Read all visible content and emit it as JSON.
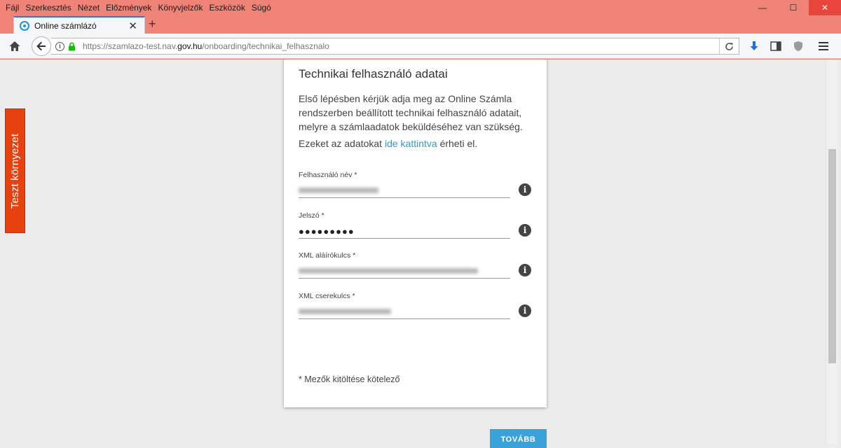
{
  "menu": [
    {
      "label": "Fájl"
    },
    {
      "label": "Szerkesztés"
    },
    {
      "label": "Nézet"
    },
    {
      "label": "Előzmények"
    },
    {
      "label": "Könyvjelzők"
    },
    {
      "label": "Eszközök"
    },
    {
      "label": "Súgó"
    }
  ],
  "window_controls": {
    "minimize": "—",
    "maximize": "☐",
    "close": "✕"
  },
  "tab": {
    "title": "Online számlázó",
    "close": "✕",
    "new_tab": "+"
  },
  "address": {
    "prefix": "https://szamlazo-test.nav.",
    "domain": "gov.hu",
    "path": "/onboarding/technikai_felhasznalo"
  },
  "side_badge": {
    "label": "Teszt környezet"
  },
  "card": {
    "title": "Technikai felhasználó adatai",
    "intro": "Első lépésben kérjük adja meg az Online Számla rendszerben beállított technikai felhasználó adatait, melyre a számlaadatok beküldéséhez van szükség.",
    "access_prefix": "Ezeket az adatokat ",
    "access_link": "ide kattintva",
    "access_suffix": " érheti el.",
    "fields": [
      {
        "label": "Felhasználó név *"
      },
      {
        "label": "Jelszó *",
        "value": "●●●●●●●●●"
      },
      {
        "label": "XML aláírókulcs *"
      },
      {
        "label": "XML cserekulcs *"
      }
    ],
    "info_glyph": "i",
    "required_note": "* Mezők kitöltése kötelező"
  },
  "next_button": {
    "label": "TOVÁBB"
  },
  "colors": {
    "accent": "#39a2d8",
    "badge": "#e6410f",
    "frame": "#f08377"
  }
}
